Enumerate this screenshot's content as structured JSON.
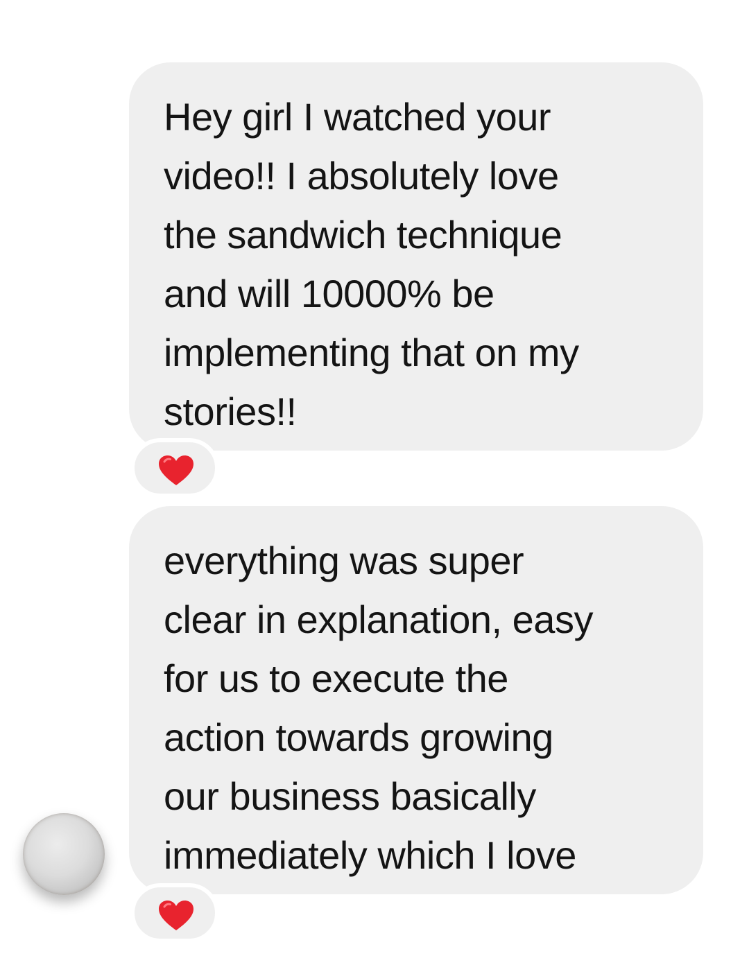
{
  "messages": [
    {
      "lines": [
        "Hey girl I watched your",
        "video!! I absolutely love",
        "the sandwich technique",
        "and will 10000% be",
        "implementing that on my",
        "stories!!"
      ],
      "reaction": "heart"
    },
    {
      "lines": [
        "everything was super",
        "clear in explanation, easy",
        "for us to execute the",
        "action towards growing",
        "our business basically",
        "immediately which I love"
      ],
      "reaction": "heart"
    }
  ],
  "colors": {
    "bubble_background": "#efefef",
    "text": "#141414",
    "heart": "#e8232e"
  },
  "icons": {
    "reaction": "heart-icon",
    "sender": "avatar"
  }
}
